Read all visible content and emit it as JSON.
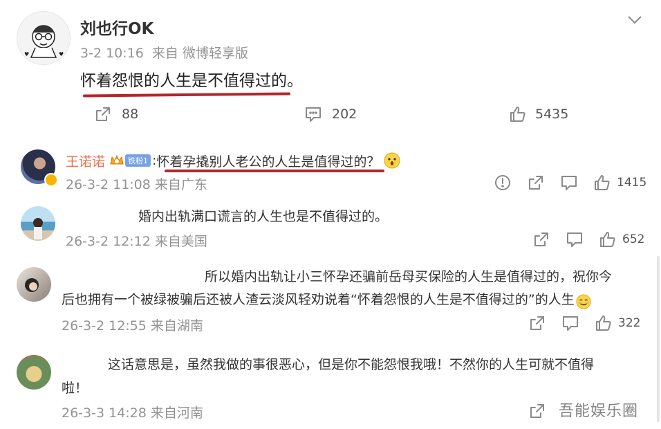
{
  "post": {
    "username": "刘也行OK",
    "meta": "3-2 10:16  来自 微博轻享版",
    "text": "怀着怨恨的人生是不值得过的。",
    "share_count": "88",
    "comment_count": "202",
    "like_count": "5435"
  },
  "comments": [
    {
      "username": "王诺诺",
      "badge": "铁粉1",
      "separator": ":",
      "text": "怀着孕撬别人老公的人生是值得过的？",
      "meta": "26-3-2 11:08 来自广东",
      "likes": "1415"
    },
    {
      "text": "婚内出轨满口谎言的人生也是不值得过的。",
      "meta": "26-3-2 12:12 来自美国",
      "likes": "652"
    },
    {
      "text_line1": "所以婚内出轨让小三怀孕还骗前岳母买保险的人生是值得过的，祝你今",
      "text_line2": "后也拥有一个被绿被骗后还被人渣云淡风轻劝说着“怀着怨恨的人生是不值得过的”的人生",
      "meta": "26-3-2 12:55 来自湖南",
      "likes": "322"
    },
    {
      "text_line1": "这话意思是，虽然我做的事很恶心，但是你不能怨恨我哦！不然你的人生可就不值得",
      "text_line2": "啦！",
      "meta": "26-3-3 14:28 来自河南"
    }
  ],
  "watermark": "吾能娱乐圈",
  "colors": {
    "underline": "#b3262b",
    "username_orange": "#eb7350",
    "meta_gray": "#939393"
  }
}
